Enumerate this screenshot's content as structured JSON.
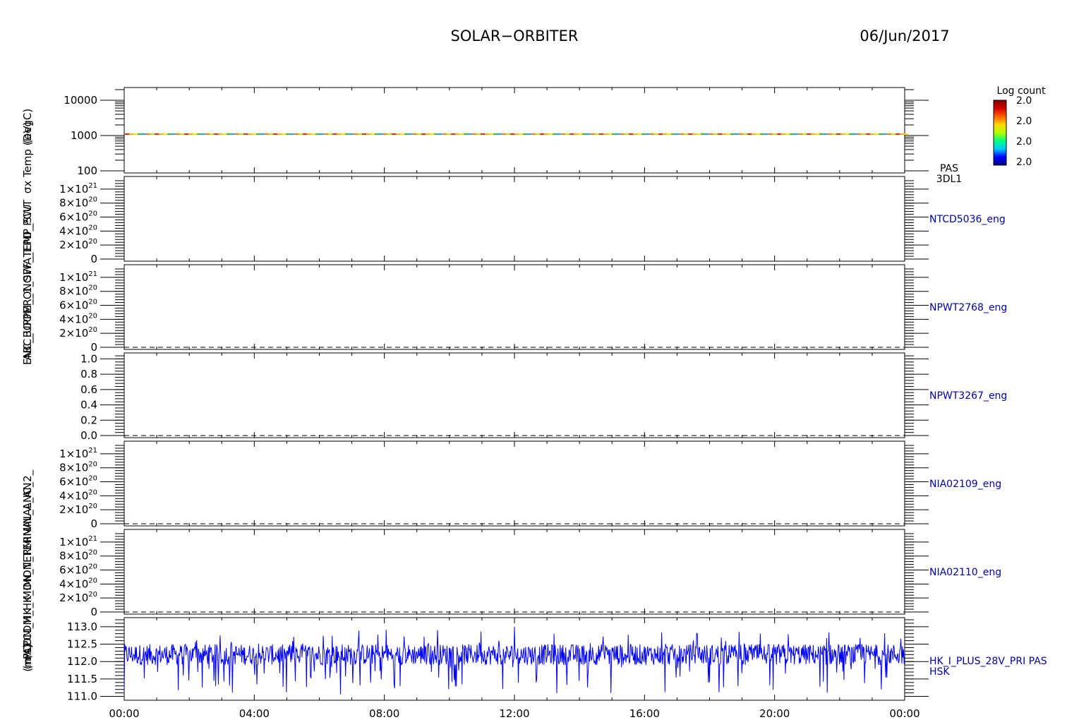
{
  "header": {
    "title": "SOLAR−ORBITER",
    "date": "06/Jun/2017"
  },
  "colorbar": {
    "label": "Log count",
    "ticks": [
      "2.0",
      "2.0",
      "2.0",
      "2.0"
    ],
    "colors": [
      "#00007f",
      "#0000ff",
      "#00c8ff",
      "#00ff80",
      "#b4ff00",
      "#ffd800",
      "#ff6000",
      "#d20000",
      "#800000"
    ]
  },
  "y_axis_label_overlap": [
    "(eV)",
    "σx Temp (DegC)",
    "ABC_UPPER_1_SWA_EPD_PCU",
    "ENC_BOOM_ONOFF_TEMP_SWT",
    "(mA)",
    "(m/s)",
    "PCDM_HK_IMON_TERMINAL_ANC_2_",
    "PCDM_HK_IMON_TERMINAL_AN"
  ],
  "x_axis": {
    "ticks": [
      "00:00",
      "04:00",
      "08:00",
      "12:00",
      "16:00",
      "20:00",
      "00:00"
    ],
    "range_hours": [
      0,
      24
    ]
  },
  "chart_data": [
    {
      "type": "heatmap",
      "id": "pas",
      "right_label": [
        "PAS",
        "3DL1"
      ],
      "yscale": "log",
      "ylim": [
        100,
        20000
      ],
      "y_ticks": [
        "10000",
        "1000",
        "100"
      ],
      "y_tick_values": [
        10000,
        1000,
        100
      ],
      "band_energy_eV": 1100,
      "band_value": 2.0,
      "x_hours": [
        0,
        24
      ]
    },
    {
      "type": "line",
      "id": "ntcd",
      "right_label": [
        "NTCD5036_eng"
      ],
      "ylim": [
        0,
        1.15e+21
      ],
      "y_ticks": [
        {
          "m": "1",
          "e": "21"
        },
        {
          "m": "8",
          "e": "20"
        },
        {
          "m": "6",
          "e": "20"
        },
        {
          "m": "4",
          "e": "20"
        },
        {
          "m": "2",
          "e": "20"
        },
        {
          "m": "0",
          "e": ""
        }
      ],
      "y_tick_values": [
        1e+21,
        8e+20,
        6e+20,
        4e+20,
        2e+20,
        0
      ],
      "baseline": false
    },
    {
      "type": "line",
      "id": "npwt2768",
      "right_label": [
        "NPWT2768_eng"
      ],
      "ylim": [
        0,
        1.15e+21
      ],
      "y_ticks": [
        {
          "m": "1",
          "e": "21"
        },
        {
          "m": "8",
          "e": "20"
        },
        {
          "m": "6",
          "e": "20"
        },
        {
          "m": "4",
          "e": "20"
        },
        {
          "m": "2",
          "e": "20"
        },
        {
          "m": "0",
          "e": ""
        }
      ],
      "y_tick_values": [
        1e+21,
        8e+20,
        6e+20,
        4e+20,
        2e+20,
        0
      ],
      "baseline": true
    },
    {
      "type": "line",
      "id": "npwt3267",
      "right_label": [
        "NPWT3267_eng"
      ],
      "ylim": [
        0,
        1.05
      ],
      "y_ticks": [
        "1.0",
        "0.8",
        "0.6",
        "0.4",
        "0.2",
        "0.0"
      ],
      "y_tick_values": [
        1.0,
        0.8,
        0.6,
        0.4,
        0.2,
        0.0
      ],
      "baseline": true
    },
    {
      "type": "line",
      "id": "nia02109",
      "right_label": [
        "NIA02109_eng"
      ],
      "ylim": [
        0,
        1.15e+21
      ],
      "y_ticks": [
        {
          "m": "1",
          "e": "21"
        },
        {
          "m": "8",
          "e": "20"
        },
        {
          "m": "6",
          "e": "20"
        },
        {
          "m": "4",
          "e": "20"
        },
        {
          "m": "2",
          "e": "20"
        },
        {
          "m": "0",
          "e": ""
        }
      ],
      "y_tick_values": [
        1e+21,
        8e+20,
        6e+20,
        4e+20,
        2e+20,
        0
      ],
      "baseline": true
    },
    {
      "type": "line",
      "id": "nia02110",
      "right_label": [
        "NIA02110_eng"
      ],
      "ylim": [
        0,
        1.15e+21
      ],
      "y_ticks": [
        {
          "m": "1",
          "e": "21"
        },
        {
          "m": "8",
          "e": "20"
        },
        {
          "m": "6",
          "e": "20"
        },
        {
          "m": "4",
          "e": "20"
        },
        {
          "m": "2",
          "e": "20"
        },
        {
          "m": "0",
          "e": ""
        }
      ],
      "y_tick_values": [
        1e+21,
        8e+20,
        6e+20,
        4e+20,
        2e+20,
        0
      ],
      "baseline": true
    },
    {
      "type": "line",
      "id": "hk",
      "right_label": [
        "HK_I_PLUS_28V_PRI PAS",
        "HSK"
      ],
      "ylim": [
        110.95,
        113.2
      ],
      "y_ticks": [
        "113.0",
        "112.5",
        "112.0",
        "111.5",
        "111.0"
      ],
      "y_tick_values": [
        113.0,
        112.5,
        112.0,
        111.5,
        111.0
      ],
      "color": "#0000ff",
      "series_summary": {
        "x_hours": [
          0,
          24
        ],
        "typical_range": [
          111.9,
          112.5
        ],
        "min": 111.05,
        "max": 113.0,
        "mean": 112.2
      }
    }
  ]
}
